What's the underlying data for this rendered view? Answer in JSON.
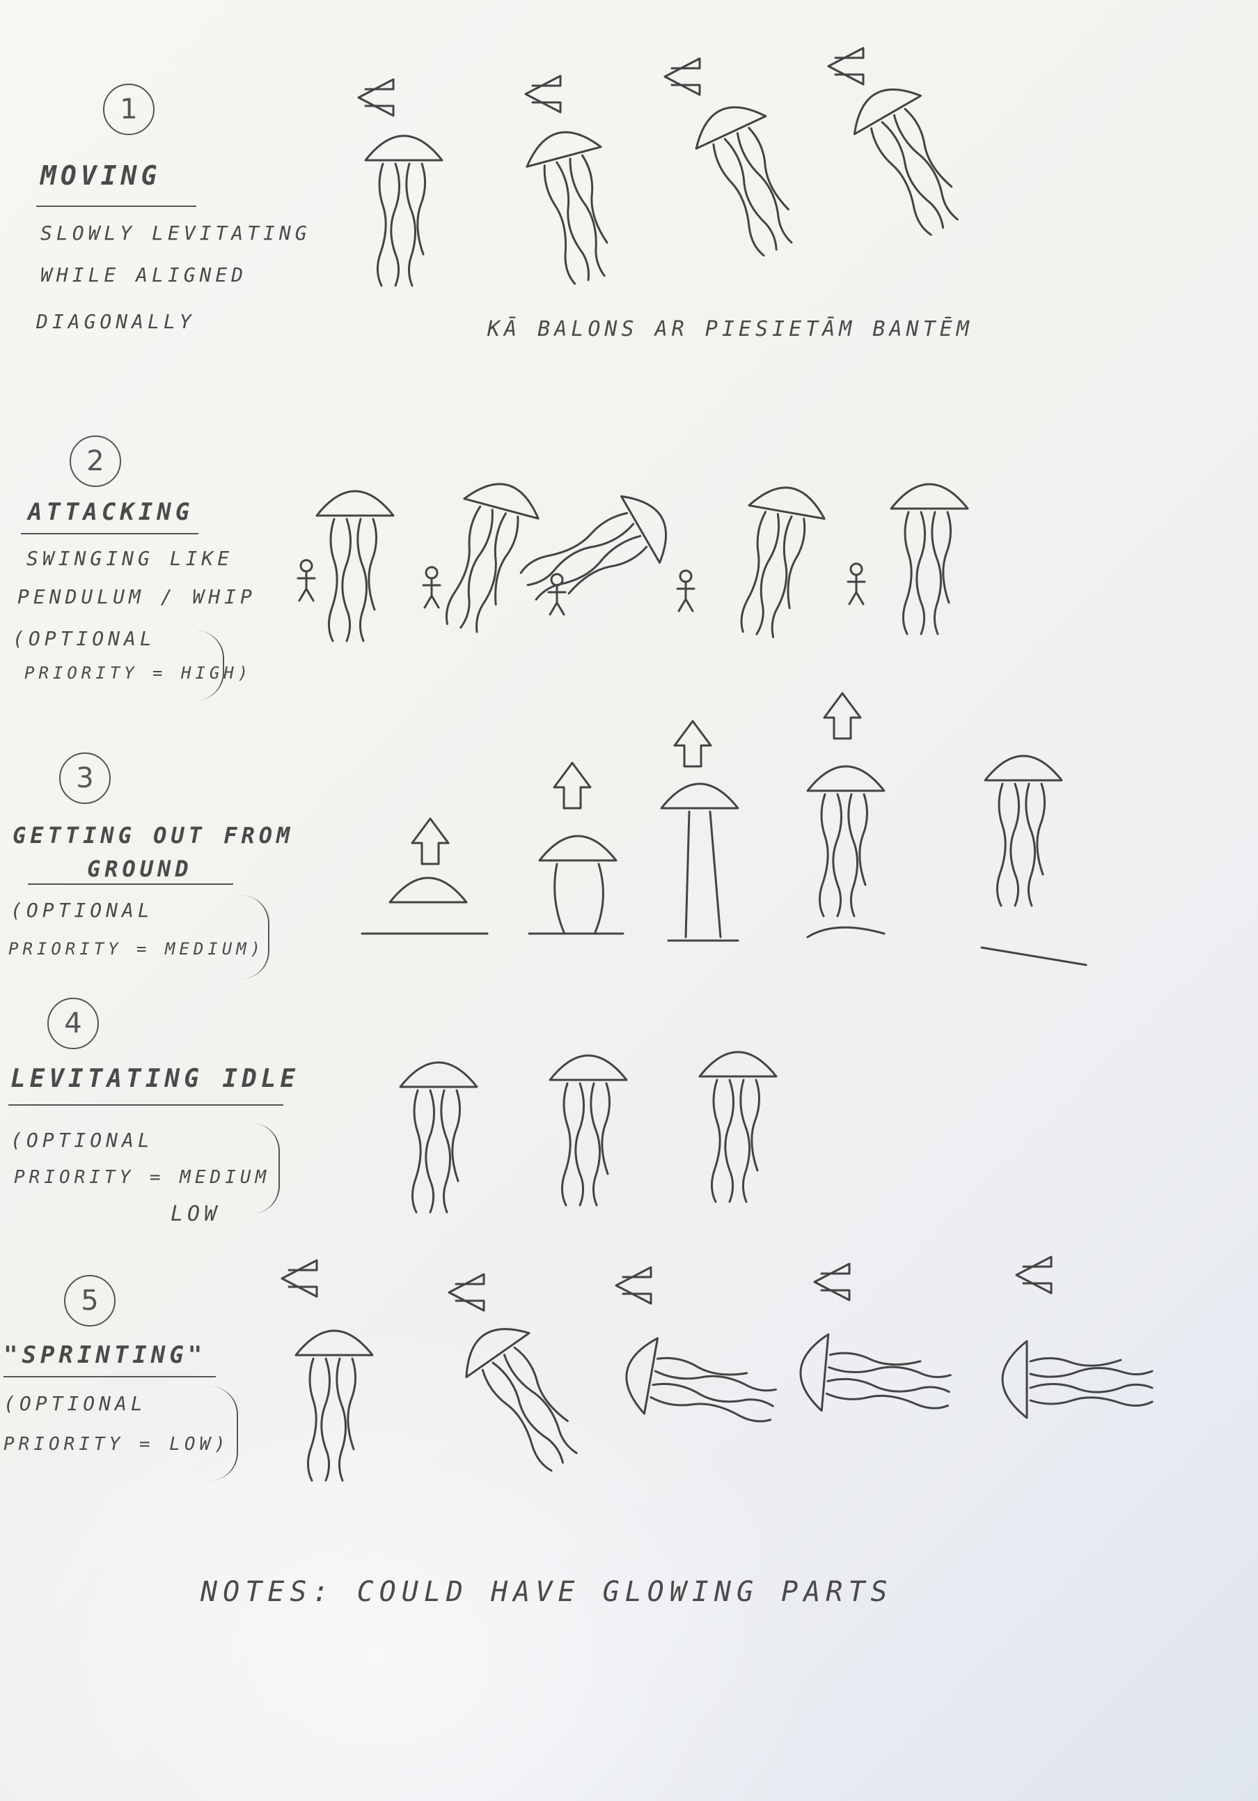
{
  "sections": [
    {
      "number": "1",
      "title": "MOVING",
      "description": [
        "SLOWLY LEVITATING",
        "WHILE ALIGNED",
        "DIAGONALLY"
      ],
      "caption": "KĀ BALONS AR PIESIETĀM BANTĒM"
    },
    {
      "number": "2",
      "title": "ATTACKING",
      "description": [
        "SWINGING LIKE",
        "PENDULUM / WHIP"
      ],
      "note": [
        "(OPTIONAL",
        "PRIORITY = HIGH)"
      ]
    },
    {
      "number": "3",
      "title": "GETTING OUT FROM",
      "title2": "GROUND",
      "note": [
        "(OPTIONAL",
        "PRIORITY = MEDIUM)"
      ]
    },
    {
      "number": "4",
      "title": "LEVITATING IDLE",
      "note": [
        "(OPTIONAL",
        "PRIORITY = MEDIUM",
        "LOW"
      ]
    },
    {
      "number": "5",
      "title": "\"SPRINTING\"",
      "note": [
        "(OPTIONAL",
        "PRIORITY = LOW)"
      ]
    }
  ],
  "footer": "NOTES: COULD HAVE GLOWING PARTS",
  "colors": {
    "ink": "#444444",
    "paper": "#f4f4f1"
  }
}
